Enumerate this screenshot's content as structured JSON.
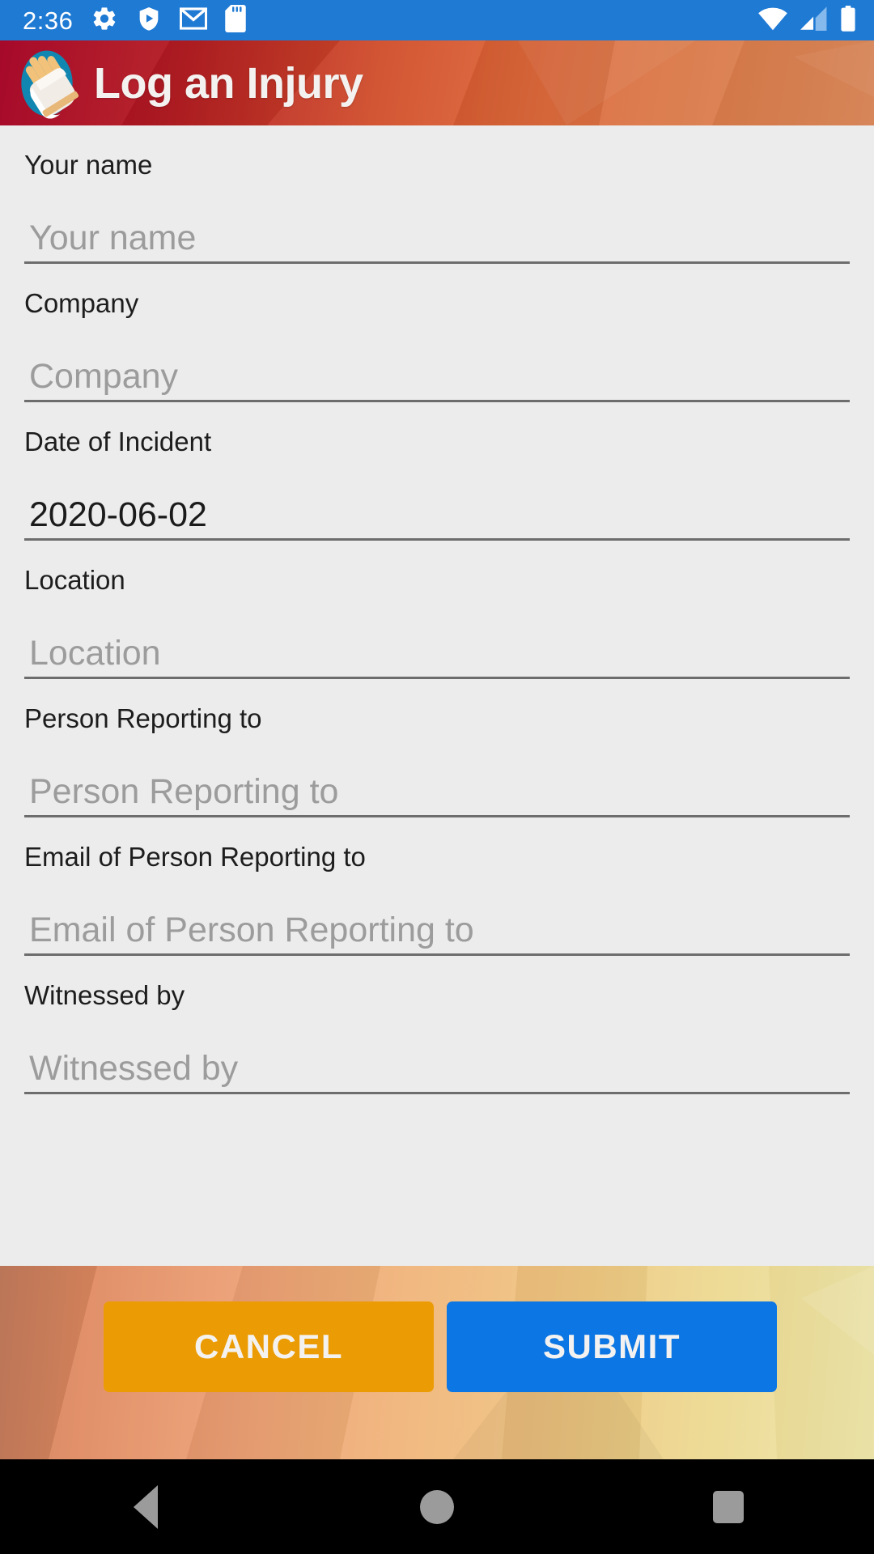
{
  "status_bar": {
    "time": "2:36",
    "left_icons": [
      "gear-icon",
      "play-protect-shield-icon",
      "gmail-icon",
      "sd-card-icon"
    ],
    "right_icons": [
      "wifi-icon",
      "cellular-signal-icon",
      "battery-icon"
    ],
    "background_color": "#1f7ad4"
  },
  "header": {
    "title": "Log an Injury",
    "logo_icon": "bandaged-hand-logo",
    "gradient_from": "#a30022",
    "gradient_to": "#dd8b5c"
  },
  "form": {
    "fields": [
      {
        "label": "Your name",
        "placeholder": "Your name",
        "value": ""
      },
      {
        "label": "Company",
        "placeholder": "Company",
        "value": ""
      },
      {
        "label": "Date of Incident",
        "placeholder": "Date of Incident",
        "value": "2020-06-02"
      },
      {
        "label": "Location",
        "placeholder": "Location",
        "value": ""
      },
      {
        "label": "Person Reporting to",
        "placeholder": "Person Reporting to",
        "value": ""
      },
      {
        "label": "Email of Person Reporting to",
        "placeholder": "Email of Person Reporting to",
        "value": ""
      },
      {
        "label": "Witnessed by",
        "placeholder": "Witnessed by",
        "value": ""
      }
    ]
  },
  "actions": {
    "cancel_label": "CANCEL",
    "submit_label": "SUBMIT",
    "cancel_color": "#eb9c04",
    "submit_color": "#0b76e4"
  },
  "nav_bar": {
    "back_icon": "triangle-back-icon",
    "home_icon": "circle-home-icon",
    "recents_icon": "square-recents-icon"
  }
}
